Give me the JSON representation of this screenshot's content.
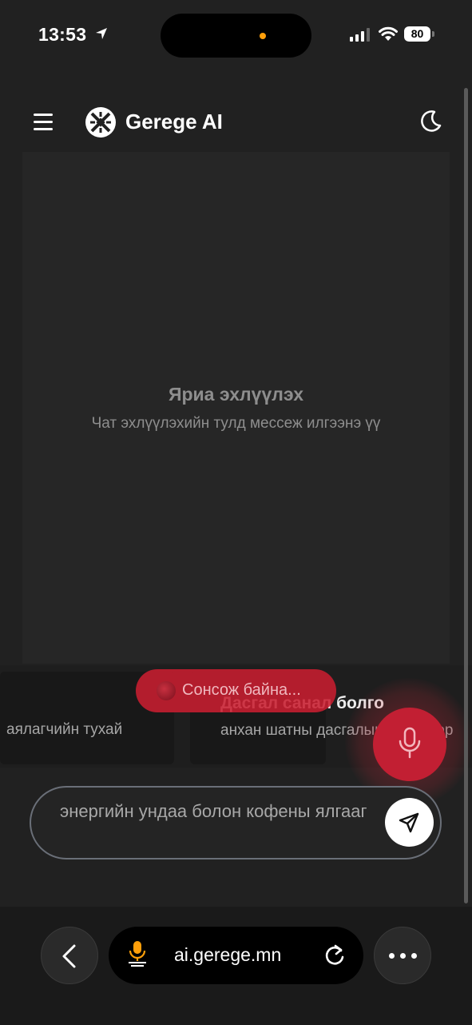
{
  "status_bar": {
    "time": "13:53",
    "battery": "80"
  },
  "header": {
    "brand": "Gerege AI"
  },
  "empty_state": {
    "title": "Яриа эхлүүлэх",
    "subtitle": "Чат эхлүүлэхийн тулд мессеж илгээнэ үү"
  },
  "suggestions": [
    {
      "title": "",
      "text": "аялагчийн тухай"
    },
    {
      "title": "Дасгал санал болго",
      "text": "анхан шатны дасгалын хөтөлбөр"
    }
  ],
  "voice": {
    "listening_label": "Сонсож байна..."
  },
  "input": {
    "value": "энергийн ундаа болон кофены ялгааг"
  },
  "browser": {
    "url": "ai.gerege.mn"
  },
  "colors": {
    "accent": "#c21f33",
    "background": "#212121"
  }
}
